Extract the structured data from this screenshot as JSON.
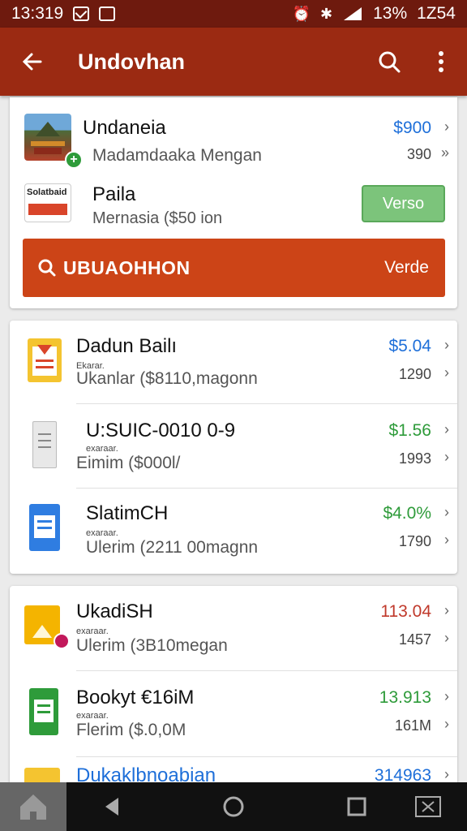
{
  "status_bar": {
    "time": "13:319",
    "battery_percent": "13%",
    "clock_right": "1Z54"
  },
  "app_bar": {
    "title": "Undovhan"
  },
  "card1": {
    "rows": [
      {
        "name": "Undaneia",
        "sub": "Madamdaaka Mengan",
        "price": "$900",
        "count": "390",
        "price_color": "#1e6fd9"
      },
      {
        "name": "Paila",
        "sub": "Mernasia ($50 ion",
        "thumb_text": "Solatbaid"
      }
    ],
    "verse_button": "Verso",
    "orange_bar": {
      "label": "UBUAOHHON",
      "right_label": "Verde"
    }
  },
  "card2": {
    "rows": [
      {
        "name": "Dadun Bailı",
        "small": "Ekarar.",
        "sub": "Ukanlar ($8110,magonn",
        "price": "$5.04",
        "count": "1290",
        "price_color": "#1e6fd9"
      },
      {
        "name": "U:SUIC-0010 0-9",
        "small": "exaraar.",
        "sub": "Eimim ($000l/",
        "price": "$1.56",
        "count": "1993",
        "price_color": "#2e9b3a"
      },
      {
        "name": "SlatimCH",
        "small": "exaraar.",
        "sub": "Ulerim (2211 00magnn",
        "price": "$4.0%",
        "count": "1790",
        "price_color": "#2e9b3a"
      }
    ]
  },
  "card3": {
    "rows": [
      {
        "name": "UkadiSH",
        "small": "exaraar.",
        "sub": "Ulerim (3B10megan",
        "price": "113.04",
        "count": "1457",
        "price_color": "#c0392b"
      },
      {
        "name": "Bookyt €16iM",
        "small": "exaraar.",
        "sub": "Flerim ($.0,0M",
        "price": "13.913",
        "count": "161M",
        "price_color": "#2e9b3a"
      },
      {
        "name": "Dukaklbnoabian",
        "price": "314963",
        "price_color": "#1e6fd9"
      }
    ]
  },
  "nav": {
    "back": "back",
    "home": "home",
    "recents": "recents"
  },
  "icons": {
    "back": "arrow-left-icon",
    "search": "search-icon",
    "menu": "more-vert-icon"
  }
}
